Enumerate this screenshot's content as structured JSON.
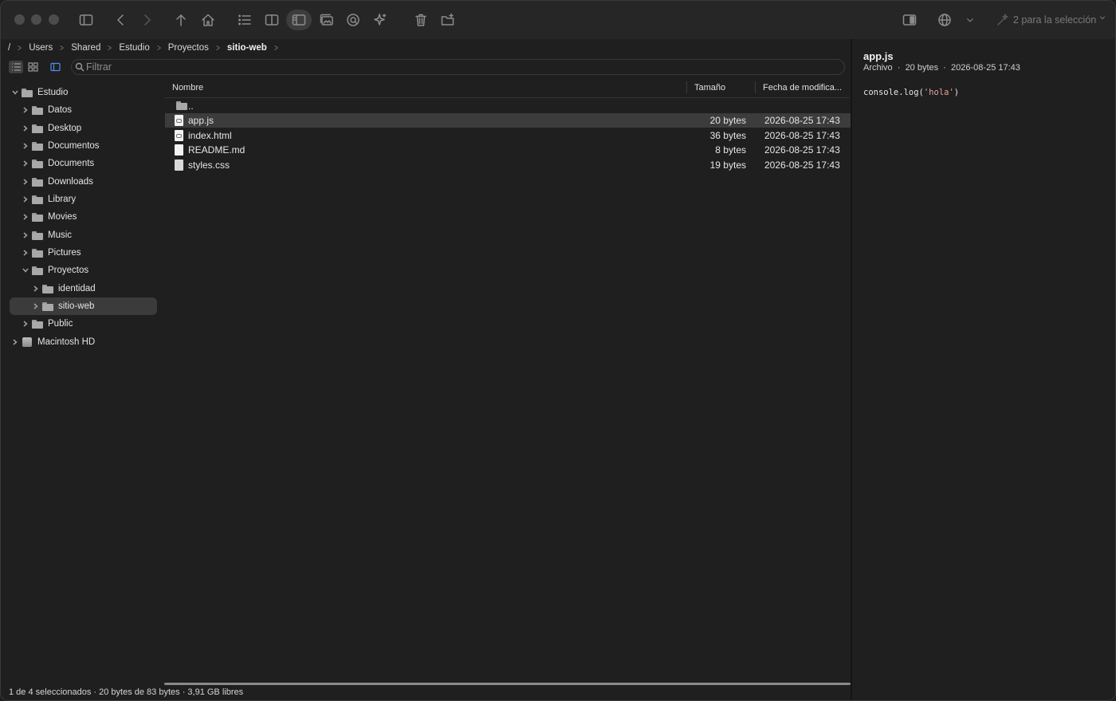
{
  "toolbar": {
    "selection_label": "2 para la selección"
  },
  "breadcrumb": [
    "/",
    "Users",
    "Shared",
    "Estudio",
    "Proyectos",
    "sitio-web"
  ],
  "filter": {
    "placeholder": "Filtrar"
  },
  "sidebar": {
    "items": [
      {
        "label": "Estudio",
        "expanded": true
      },
      {
        "label": "Datos",
        "expanded": false
      },
      {
        "label": "Desktop",
        "expanded": false
      },
      {
        "label": "Documentos",
        "expanded": false
      },
      {
        "label": "Documents",
        "expanded": false
      },
      {
        "label": "Downloads",
        "expanded": false
      },
      {
        "label": "Library",
        "expanded": false
      },
      {
        "label": "Movies",
        "expanded": false
      },
      {
        "label": "Music",
        "expanded": false
      },
      {
        "label": "Pictures",
        "expanded": false
      },
      {
        "label": "Proyectos",
        "expanded": true
      },
      {
        "label": "identidad",
        "expanded": false
      },
      {
        "label": "sitio-web",
        "expanded": false,
        "selected": true
      },
      {
        "label": "Public",
        "expanded": false
      },
      {
        "label": "Macintosh HD",
        "expanded": false
      }
    ]
  },
  "file_list": {
    "columns": {
      "name": "Nombre",
      "size": "Tamaño",
      "date": "Fecha de modifica..."
    },
    "parent": "..",
    "rows": [
      {
        "name": "app.js",
        "size": "20 bytes",
        "date": "2026-08-25 17:43",
        "selected": true
      },
      {
        "name": "index.html",
        "size": "36 bytes",
        "date": "2026-08-25 17:43"
      },
      {
        "name": "README.md",
        "size": "8 bytes",
        "date": "2026-08-25 17:43"
      },
      {
        "name": "styles.css",
        "size": "19 bytes",
        "date": "2026-08-25 17:43"
      }
    ]
  },
  "status": "1 de 4 seleccionados · 20 bytes de 83 bytes · 3,91 GB libres",
  "preview": {
    "title": "app.js",
    "meta": "Archivo  ·  20 bytes  ·  2026-08-25 17:43",
    "code_prefix": "console.log(",
    "code_string": "'hola'",
    "code_suffix": ")"
  },
  "colors": {
    "background": "#1f1f1f",
    "selection": "#3c3c3c",
    "accent_blue": "#4d8ef0",
    "code_string": "#e8a0a0"
  }
}
